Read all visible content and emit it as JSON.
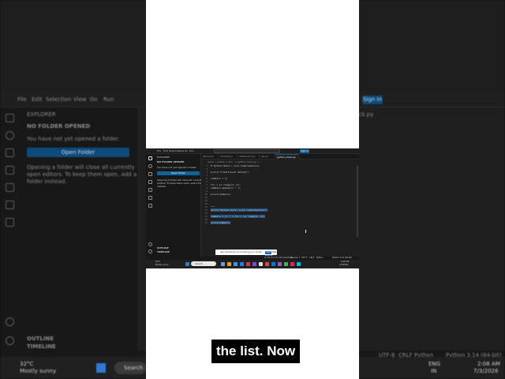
{
  "background": {
    "menu": [
      "File",
      "Edit",
      "Selection",
      "View",
      "Go",
      "Run"
    ],
    "sign_in": "Sign in",
    "tab_name": "n_hack.py",
    "explorer_title": "EXPLORER",
    "no_folder": "NO FOLDER OPENED",
    "no_folder_msg": "You have not yet opened a folder.",
    "open_folder_btn": "Open Folder",
    "folder_note": "Opening a folder will close all currently open editors. To keep them open, add a folder instead.",
    "outline": "OUTLINE",
    "timeline": "TIMELINE",
    "weather_temp": "32°C",
    "weather_desc": "Mostly sunny",
    "search_placeholder": "Search",
    "status_encoding": "UTF-8",
    "status_eol": "CRLF",
    "status_lang": "Python",
    "status_interp": "Python 3.14 (64-bit)",
    "lang": "ENG",
    "region": "IN",
    "time": "2:08 AM",
    "date": "7/3/2026"
  },
  "screenshot": {
    "menu": [
      "File",
      "Edit",
      "Selection",
      "View",
      "Go",
      "Run"
    ],
    "sign_in": "Sign in",
    "sidebar": {
      "title": "EXPLORER",
      "no_folder": "NO FOLDER OPENED",
      "msg": "You have not yet opened a folder.",
      "btn": "Open Folder",
      "note1": "Opening a folder will close all currently open",
      "note2": "editors. To keep them open, add a folder",
      "note3": "instead.",
      "outline": "OUTLINE",
      "timeline": "TIMELINE"
    },
    "tabs": [
      "Welcome",
      "lambda.py",
      "dashboard.py",
      "list.py",
      "python_hack.py"
    ],
    "breadcrumb": "Users > admin > Do... > python_hack.py > ...",
    "code": [
      {
        "n": "1",
        "t": "# Python Basic: List Comprehension",
        "sel": false
      },
      {
        "n": "2",
        "t": "",
        "sel": false
      },
      {
        "n": "3",
        "t": "print(\"Traditional Method\")",
        "sel": false
      },
      {
        "n": "4",
        "t": "",
        "sel": false
      },
      {
        "n": "5",
        "t": "numbers = []",
        "sel": false
      },
      {
        "n": "6",
        "t": "",
        "sel": false
      },
      {
        "n": "7",
        "t": "for i in range(1, 6):",
        "sel": false
      },
      {
        "n": "8",
        "t": "    numbers.append(i * i)",
        "sel": false
      },
      {
        "n": "9",
        "t": "",
        "sel": false
      },
      {
        "n": "10",
        "t": "print(numbers)",
        "sel": false
      },
      {
        "n": "11",
        "t": "",
        "sel": false
      },
      {
        "n": "12",
        "t": "",
        "sel": false
      },
      {
        "n": "13",
        "t": "",
        "sel": false
      },
      {
        "n": "14",
        "t": "\"\"\"",
        "sel": false
      },
      {
        "n": "15",
        "t": "print(\"Python Hack: List Comprehension\")",
        "sel": true
      },
      {
        "n": "16",
        "t": "",
        "sel": true
      },
      {
        "n": "17",
        "t": "numbers = [i * i for i in range(1, 6)]",
        "sel": true
      },
      {
        "n": "18",
        "t": "",
        "sel": true
      },
      {
        "n": "19",
        "t": "print(numbers)",
        "sel": true
      }
    ],
    "share_msg": "app.clipchamp.com is sharing your screen.",
    "share_stop": "Stop sharing",
    "share_hide": "Hide",
    "status_left": "Ln 19, Col 15 (124 selected)",
    "status_spaces": "Spaces: 4",
    "status_enc": "UTF-8",
    "status_eol": "CRLF",
    "status_lang": "Python",
    "status_interp": "Python 3.14 (64-bit)",
    "weather_temp": "32°C",
    "weather_desc": "Mostly sunny",
    "search": "Search",
    "time": "2:08 AM",
    "date": "7/3/2026"
  },
  "caption": "the list. Now"
}
